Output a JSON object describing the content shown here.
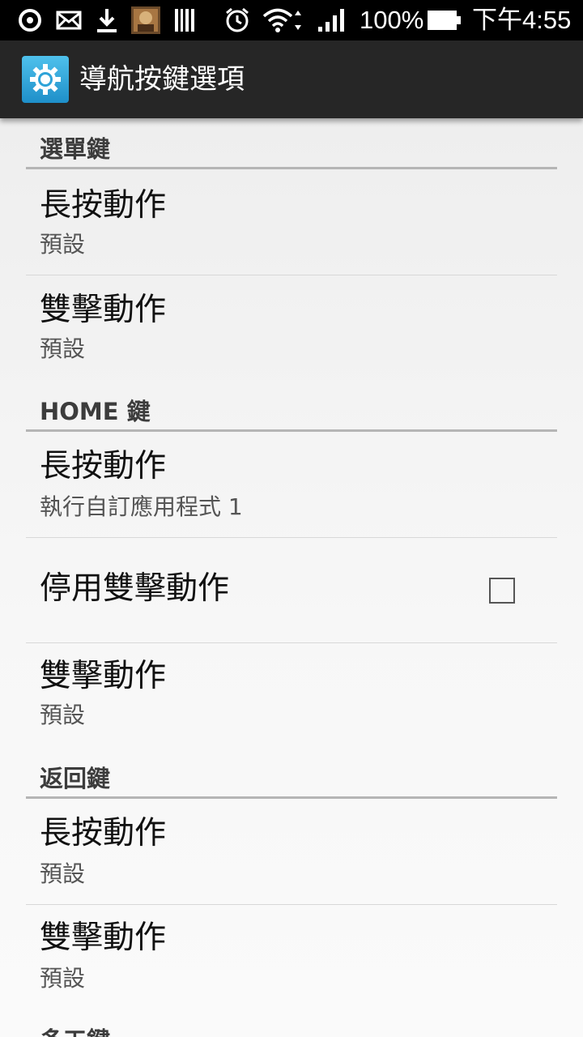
{
  "status_bar": {
    "battery": "100%",
    "time": "下午4:55",
    "icons": [
      "sync-icon",
      "mail-icon",
      "download-icon",
      "app-thumbnail-icon",
      "barcode-icon",
      "alarm-icon",
      "wifi-icon",
      "signal-icon",
      "battery-icon"
    ]
  },
  "action_bar": {
    "title": "導航按鍵選項",
    "icon": "settings-gear-icon"
  },
  "sections": [
    {
      "header": "選單鍵",
      "items": [
        {
          "title": "長按動作",
          "summary": "預設"
        },
        {
          "title": "雙擊動作",
          "summary": "預設"
        }
      ]
    },
    {
      "header": "HOME 鍵",
      "items": [
        {
          "title": "長按動作",
          "summary": "執行自訂應用程式 1"
        },
        {
          "title": "停用雙擊動作",
          "checked": false
        },
        {
          "title": "雙擊動作",
          "summary": "預設"
        }
      ]
    },
    {
      "header": "返回鍵",
      "items": [
        {
          "title": "長按動作",
          "summary": "預設"
        },
        {
          "title": "雙擊動作",
          "summary": "預設"
        }
      ]
    },
    {
      "header": "多工鍵",
      "items": []
    }
  ],
  "colors": {
    "status_bar": "#000000",
    "action_bar": "#262626",
    "app_icon": "#2ea3d8",
    "header_rule": "#b5b5b5"
  }
}
